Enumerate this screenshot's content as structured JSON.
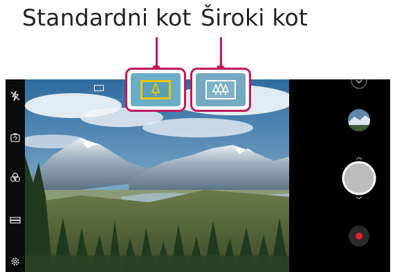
{
  "callouts": {
    "standard_label": "Standardni kot",
    "wide_label": "Široki kot"
  },
  "icons": {
    "flash": "flash-off-icon",
    "switch_camera": "camera-switch-icon",
    "filter": "filter-icon",
    "ratio": "aspect-ratio-icon",
    "settings": "gear-icon",
    "standard_lens": "single-tree-icon",
    "wide_lens": "three-trees-icon",
    "mode_menu": "chevron-down-icon",
    "gallery": "gallery-thumbnail",
    "shutter": "shutter-button",
    "record": "record-button"
  },
  "colors": {
    "leader": "#c2185b",
    "standard_active": "#f4c400",
    "record": "#e0202a"
  }
}
